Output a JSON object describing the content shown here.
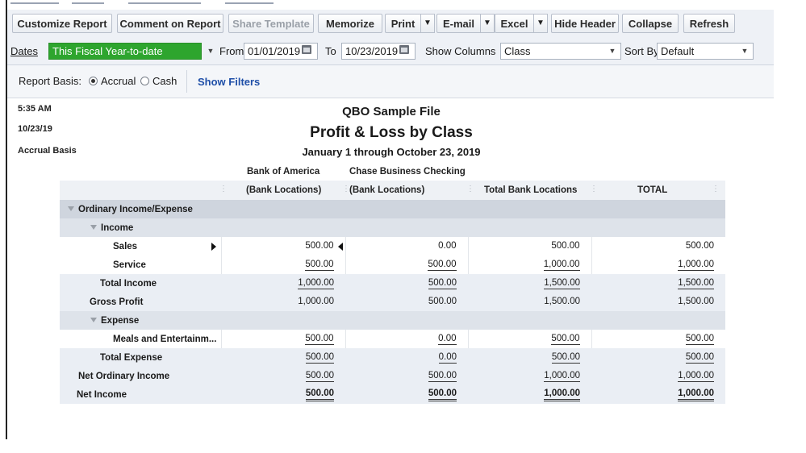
{
  "toolbar": {
    "customize": "Customize Report",
    "comment": "Comment on Report",
    "share": "Share Template",
    "memorize": "Memorize",
    "print": "Print",
    "email": "E-mail",
    "excel": "Excel",
    "hide_header": "Hide Header",
    "collapse": "Collapse",
    "refresh": "Refresh"
  },
  "filters": {
    "dates_label": "Dates",
    "dates_value": "This Fiscal Year-to-date",
    "from_label": "From",
    "from_value": "01/01/2019",
    "to_label": "To",
    "to_value": "10/23/2019",
    "show_columns_label": "Show Columns",
    "show_columns_value": "Class",
    "sort_by_label": "Sort By",
    "sort_by_value": "Default"
  },
  "basis": {
    "label": "Report Basis:",
    "accrual": "Accrual",
    "cash": "Cash",
    "show_filters": "Show Filters"
  },
  "report": {
    "time": "5:35 AM",
    "date": "10/23/19",
    "basis": "Accrual Basis",
    "company": "QBO Sample File",
    "title": "Profit & Loss by Class",
    "period": "January 1 through October 23, 2019",
    "col1_line1": "Bank of America",
    "col1_line2": "(Bank Locations)",
    "col2_line1": "Chase Business Checking",
    "col2_line2": "(Bank Locations)",
    "col3": "Total Bank Locations",
    "col4": "TOTAL",
    "rows": [
      {
        "label": "Ordinary Income/Expense",
        "v": [
          "",
          "",
          "",
          ""
        ]
      },
      {
        "label": "Income",
        "v": [
          "",
          "",
          "",
          ""
        ]
      },
      {
        "label": "Sales",
        "v": [
          "500.00",
          "0.00",
          "500.00",
          "500.00"
        ]
      },
      {
        "label": "Service",
        "v": [
          "500.00",
          "500.00",
          "1,000.00",
          "1,000.00"
        ]
      },
      {
        "label": "Total Income",
        "v": [
          "1,000.00",
          "500.00",
          "1,500.00",
          "1,500.00"
        ]
      },
      {
        "label": "Gross Profit",
        "v": [
          "1,000.00",
          "500.00",
          "1,500.00",
          "1,500.00"
        ]
      },
      {
        "label": "Expense",
        "v": [
          "",
          "",
          "",
          ""
        ]
      },
      {
        "label": "Meals and Entertainm...",
        "v": [
          "500.00",
          "0.00",
          "500.00",
          "500.00"
        ]
      },
      {
        "label": "Total Expense",
        "v": [
          "500.00",
          "0.00",
          "500.00",
          "500.00"
        ]
      },
      {
        "label": "Net Ordinary Income",
        "v": [
          "500.00",
          "500.00",
          "1,000.00",
          "1,000.00"
        ]
      },
      {
        "label": "Net Income",
        "v": [
          "500.00",
          "500.00",
          "1,000.00",
          "1,000.00"
        ]
      }
    ]
  }
}
